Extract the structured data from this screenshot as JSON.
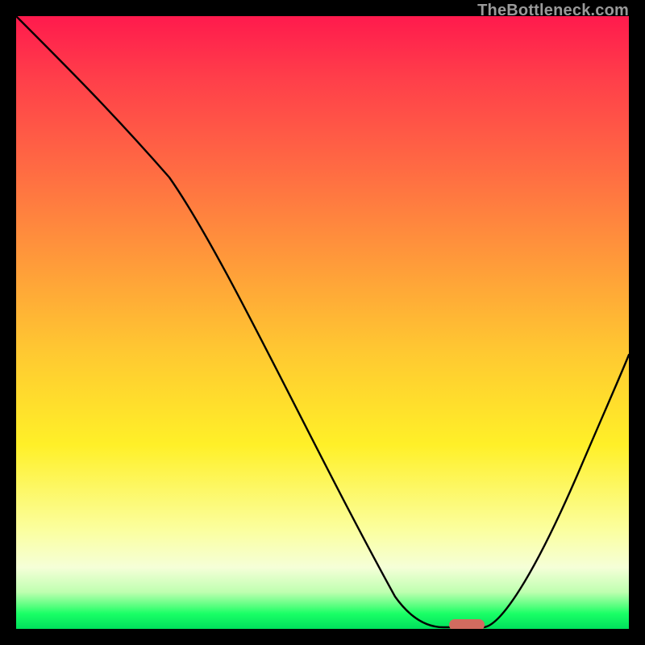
{
  "watermark": "TheBottleneck.com",
  "chart_data": {
    "type": "line",
    "title": "",
    "xlabel": "",
    "ylabel": "",
    "xlim": [
      0,
      100
    ],
    "ylim": [
      0,
      100
    ],
    "x": [
      0,
      5,
      10,
      15,
      20,
      25,
      30,
      35,
      40,
      45,
      50,
      55,
      60,
      63,
      66,
      70,
      75,
      80,
      85,
      90,
      95,
      100
    ],
    "values": [
      100,
      95,
      90,
      85,
      80,
      74,
      66,
      57,
      48,
      39,
      30,
      21,
      12,
      5,
      1,
      0,
      0,
      4,
      12,
      22,
      33,
      45
    ],
    "annotations": [
      {
        "type": "marker",
        "x": 73,
        "y": 0,
        "shape": "pill",
        "color": "#d16b5f"
      }
    ]
  },
  "colors": {
    "gradient_top": "#ff1a4d",
    "gradient_mid": "#ffd633",
    "gradient_bottom": "#00e05c",
    "line": "#000000",
    "marker": "#d16b5f",
    "frame": "#000000",
    "watermark": "#9a9a9a"
  }
}
